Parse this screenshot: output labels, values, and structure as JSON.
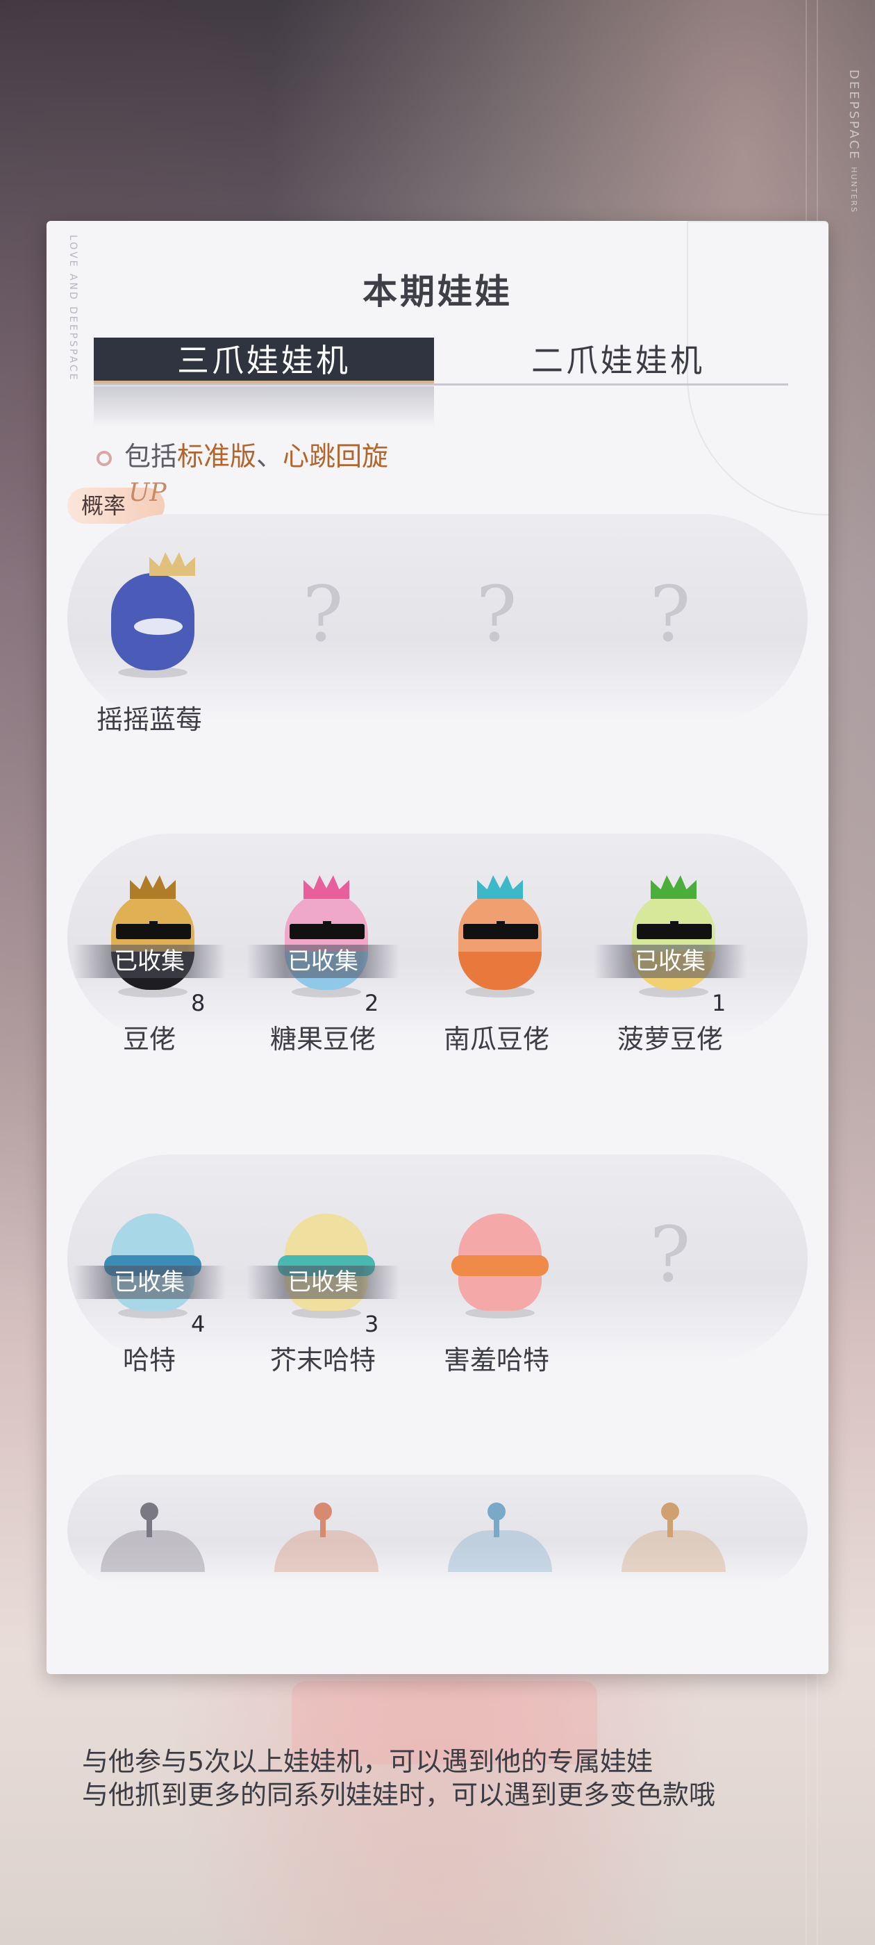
{
  "brand": {
    "line1": "DEEPSPACE",
    "line2": "HUNTERS"
  },
  "card": {
    "side_text": "LOVE AND DEEPSPACE",
    "title": "本期娃娃",
    "tabs": [
      {
        "label": "三爪娃娃机",
        "active": true
      },
      {
        "label": "二爪娃娃机",
        "active": false
      }
    ],
    "info": {
      "prefix": "包括",
      "highlight1": "标准版",
      "sep": "、",
      "highlight2": "心跳回旋"
    },
    "up_badge": {
      "label": "概率",
      "up": "UP"
    },
    "rows": [
      {
        "items": [
          {
            "name": "摇摇蓝莓",
            "known": true,
            "collected": false,
            "count": "",
            "color": "#4a5bb8",
            "accent": "#e0c07a"
          },
          {
            "known": false,
            "qmark": "?"
          },
          {
            "known": false,
            "qmark": "?"
          },
          {
            "known": false,
            "qmark": "?"
          }
        ]
      },
      {
        "items": [
          {
            "name": "豆佬",
            "known": true,
            "collected": true,
            "collected_label": "已收集",
            "count": "8",
            "color": "#e0b054",
            "accent": "#b07c28",
            "suit": "#1d1d22"
          },
          {
            "name": "糖果豆佬",
            "known": true,
            "collected": true,
            "collected_label": "已收集",
            "count": "2",
            "color": "#f0a8c8",
            "accent": "#e85f9c",
            "suit": "#8fc8e8"
          },
          {
            "name": "南瓜豆佬",
            "known": true,
            "collected": false,
            "count": "",
            "color": "#f0a070",
            "accent": "#3cb8c8",
            "suit": "#e8783c"
          },
          {
            "name": "菠萝豆佬",
            "known": true,
            "collected": true,
            "collected_label": "已收集",
            "count": "1",
            "color": "#d8e89a",
            "accent": "#4cae3a",
            "suit": "#f0d070"
          }
        ]
      },
      {
        "items": [
          {
            "name": "哈特",
            "known": true,
            "collected": true,
            "collected_label": "已收集",
            "count": "4",
            "color": "#a8d8e8",
            "accent": "#3c8cb8"
          },
          {
            "name": "芥末哈特",
            "known": true,
            "collected": true,
            "collected_label": "已收集",
            "count": "3",
            "color": "#f0e0a0",
            "accent": "#48b8b0"
          },
          {
            "name": "害羞哈特",
            "known": true,
            "collected": false,
            "count": "",
            "color": "#f4a8a8",
            "accent": "#f08a48"
          },
          {
            "known": false,
            "qmark": "?"
          }
        ]
      },
      {
        "partial_colors": [
          "#7a7880",
          "#d88a70",
          "#7aa8c8",
          "#d0a070"
        ]
      }
    ]
  },
  "footer": {
    "line1": "与他参与5次以上娃娃机，可以遇到他的专属娃娃",
    "line2": "与他抓到更多的同系列娃娃时，可以遇到更多变色款哦"
  }
}
